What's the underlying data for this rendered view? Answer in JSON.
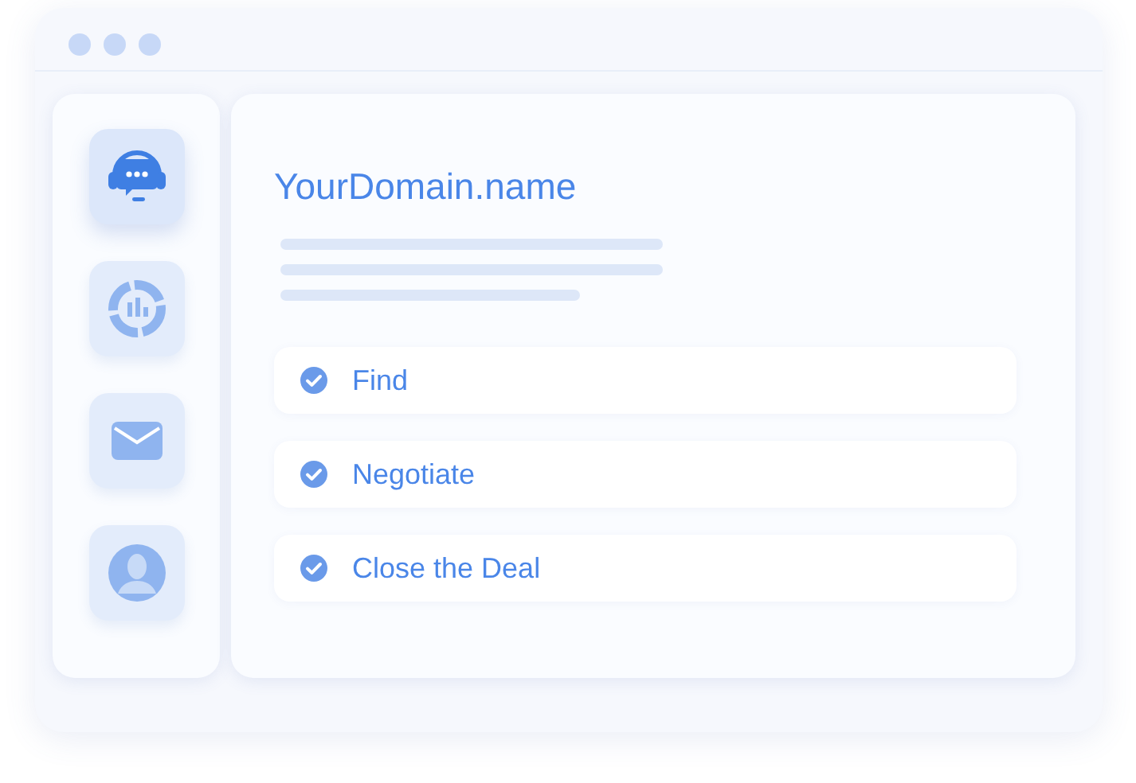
{
  "sidebar": {
    "items": [
      {
        "kind": "support",
        "selected": true
      },
      {
        "kind": "chart",
        "selected": false
      },
      {
        "kind": "mail",
        "selected": false
      },
      {
        "kind": "user",
        "selected": false
      }
    ]
  },
  "main": {
    "title": "YourDomain.name",
    "checklist": [
      {
        "label": "Find",
        "checked": true
      },
      {
        "label": "Negotiate",
        "checked": true
      },
      {
        "label": "Close the Deal",
        "checked": true
      }
    ]
  }
}
